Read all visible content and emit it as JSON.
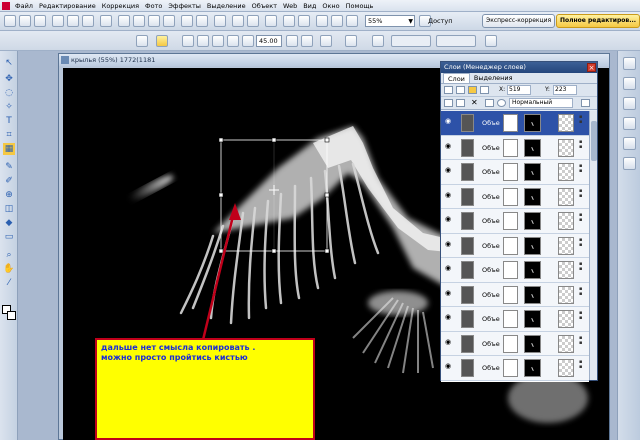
{
  "menubar": {
    "items": [
      "Файл",
      "Редактирование",
      "Коррекция",
      "Фото",
      "Эффекты",
      "Выделение",
      "Объект",
      "Web",
      "Вид",
      "Окно",
      "Помощь"
    ]
  },
  "toolbar": {
    "zoom_value": "55%",
    "access_label": "Доступ",
    "express_label": "Экспресс-коррекция",
    "full_edit_label": "Полное редактиров..."
  },
  "options_bar": {
    "angle_value": "45.00"
  },
  "image_window": {
    "title": "крылья (55%) 1772(1181"
  },
  "annotation": {
    "line1": "дальше нет смысла копировать .",
    "line2": "можно просто пройтись кистью"
  },
  "layers_panel": {
    "title": "Слои (Менеджер слоев)",
    "tabs": [
      "Слои",
      "Выделения"
    ],
    "x_label": "X:",
    "x_value": "519",
    "y_label": "Y:",
    "y_value": "223",
    "blend_mode": "Нормальный",
    "layers": [
      {
        "name": "Объе",
        "selected": true
      },
      {
        "name": "Объе",
        "selected": false
      },
      {
        "name": "Объе",
        "selected": false
      },
      {
        "name": "Объе",
        "selected": false
      },
      {
        "name": "Объе",
        "selected": false
      },
      {
        "name": "Объе",
        "selected": false
      },
      {
        "name": "Объе",
        "selected": false
      },
      {
        "name": "Объе",
        "selected": false
      },
      {
        "name": "Объе",
        "selected": false
      },
      {
        "name": "Объе",
        "selected": false
      },
      {
        "name": "Объе",
        "selected": false
      }
    ]
  },
  "colors": {
    "callout_bg": "#ffff00",
    "callout_border": "#c0001a",
    "callout_text": "#1a2bd8",
    "selection_row": "#2d52a8"
  }
}
